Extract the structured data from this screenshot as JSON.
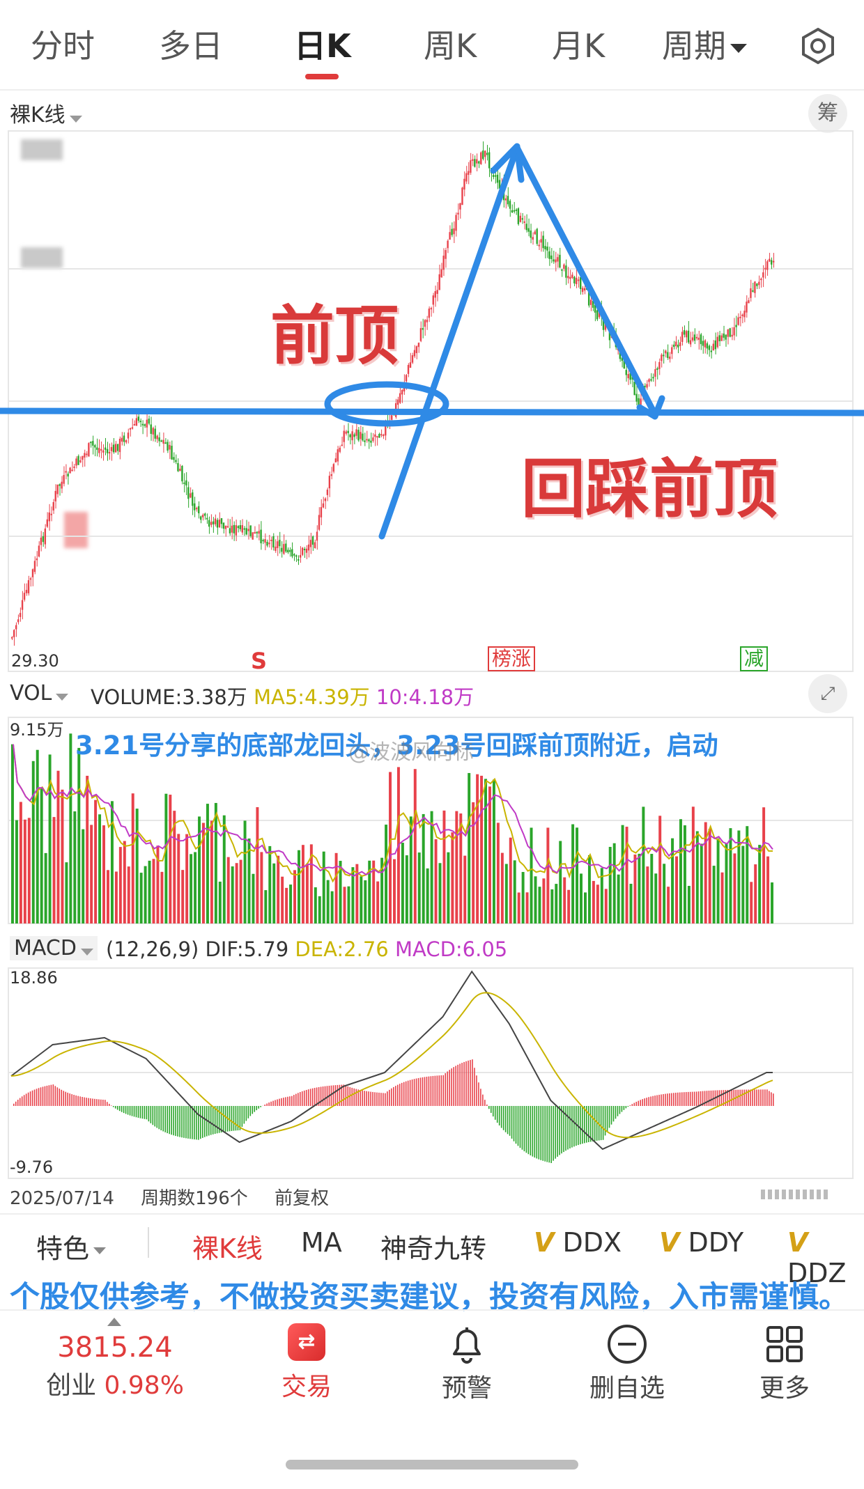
{
  "tabs": [
    {
      "label": "分时"
    },
    {
      "label": "多日"
    },
    {
      "label": "日K"
    },
    {
      "label": "周K"
    },
    {
      "label": "月K"
    },
    {
      "label": "周期"
    }
  ],
  "active_tab": "日K",
  "kline": {
    "type_label": "裸K线",
    "chip_button": "筹",
    "low_label": "29.30",
    "flags": {
      "sell": "S",
      "rank": "榜涨",
      "reduce": "减"
    },
    "annotations": {
      "prev_top": "前顶",
      "pullback": "回踩前顶"
    }
  },
  "volume": {
    "label": "VOL",
    "volume_text": "VOLUME:3.38万",
    "ma5_text": "MA5:4.39万",
    "ma10_text": "10:4.18万",
    "max_label": "9.15万",
    "caption": "3.21号分享的底部龙回头，3.23号回踩前顶附近，启动",
    "watermark": "@波波风向标"
  },
  "macd": {
    "label": "MACD",
    "params": "(12,26,9)",
    "dif_text": "DIF:5.79",
    "dea_text": "DEA:2.76",
    "macd_text": "MACD:6.05",
    "max_label": "18.86",
    "min_label": "-9.76"
  },
  "footer_info": {
    "date": "2025/07/14",
    "period_count": "周期数196个",
    "adjust": "前复权"
  },
  "toolbar": {
    "feature": "特色",
    "items": [
      "裸K线",
      "MA",
      "神奇九转"
    ],
    "v_items": [
      "DDX",
      "DDY",
      "DDZ"
    ]
  },
  "disclaimer": "个股仅供参考，不做投资买卖建议，投资有风险，入市需谨慎。",
  "bottom_nav": {
    "index_value": "3815.24",
    "index_name": "创业",
    "index_change": "0.98%",
    "trade": "交易",
    "alert": "预警",
    "remove": "删自选",
    "more": "更多"
  },
  "colors": {
    "up": "#e8414a",
    "down": "#2aa52a",
    "annotation_blue": "#2f8ae6",
    "annotation_red": "#d93a3a",
    "ma5": "#c9b400",
    "ma10": "#c03ac6",
    "dif": "#444444",
    "dea": "#c9b400"
  }
}
